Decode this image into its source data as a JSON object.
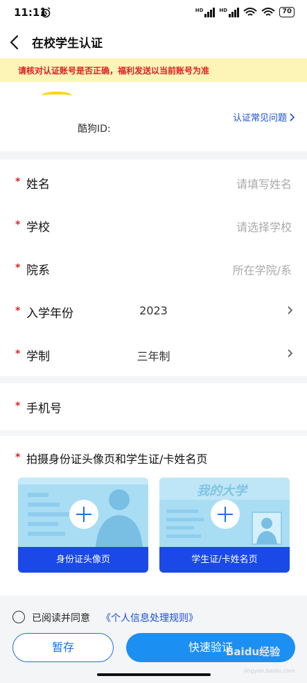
{
  "status_bar": {
    "time": "11:11",
    "battery": "70"
  },
  "header": {
    "title": "在校学生认证"
  },
  "notice": {
    "text": "请核对认证账号是否正确，福利发送以当前账号为准"
  },
  "account": {
    "kugou_id_label": "酷狗ID:",
    "faq_link": "认证常见问题"
  },
  "form": {
    "name": {
      "label": "姓名",
      "placeholder": "请填写姓名"
    },
    "school": {
      "label": "学校",
      "placeholder": "请选择学校"
    },
    "department": {
      "label": "院系",
      "placeholder": "所在学院/系"
    },
    "enroll_year": {
      "label": "入学年份",
      "value": "2023"
    },
    "program_length": {
      "label": "学制",
      "value": "三年制"
    },
    "phone": {
      "label": "手机号"
    },
    "required_mark": "*"
  },
  "photos": {
    "title": "拍摄身份证头像页和学生证/卡姓名页",
    "id_card_label": "身份证头像页",
    "student_card_label": "学生证/卡姓名页",
    "student_card_art_text": "我的大学"
  },
  "agreement": {
    "text": "已阅读并同意",
    "link": "《个人信息处理规则》"
  },
  "buttons": {
    "save": "暂存",
    "verify": "快速验证"
  },
  "watermark": {
    "text": "Baidu经验",
    "sub": "jingyan.baidu.com"
  },
  "colors": {
    "accent": "#1c6fe6",
    "required": "#e02020",
    "notice_bg": "#fdf4b8",
    "link": "#1c4fd8"
  }
}
